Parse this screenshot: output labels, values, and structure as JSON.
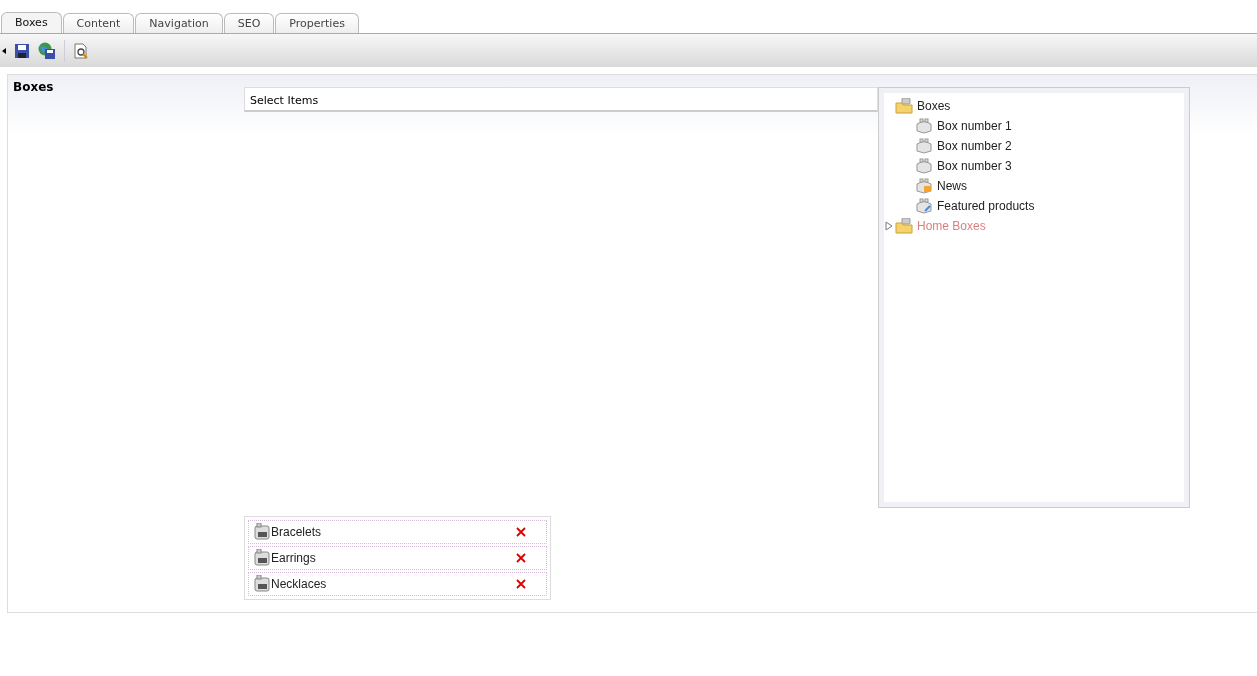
{
  "tabs": [
    {
      "label": "Boxes",
      "selected": true
    },
    {
      "label": "Content",
      "selected": false
    },
    {
      "label": "Navigation",
      "selected": false
    },
    {
      "label": "SEO",
      "selected": false
    },
    {
      "label": "Properties",
      "selected": false
    }
  ],
  "panel": {
    "label": "Boxes",
    "select_header": "Select Items",
    "tree": [
      {
        "label": "Boxes",
        "kind": "folder",
        "highlighted": false,
        "children": [
          {
            "label": "Box number 1",
            "kind": "box",
            "highlighted": false
          },
          {
            "label": "Box number 2",
            "kind": "box",
            "highlighted": false
          },
          {
            "label": "Box number 3",
            "kind": "box",
            "highlighted": false
          },
          {
            "label": "News",
            "kind": "news",
            "highlighted": false
          },
          {
            "label": "Featured products",
            "kind": "featured",
            "highlighted": false
          }
        ]
      },
      {
        "label": "Home Boxes",
        "kind": "folder",
        "highlighted": true,
        "expanded": false
      }
    ],
    "selected_items": [
      {
        "label": "Bracelets"
      },
      {
        "label": "Earrings"
      },
      {
        "label": "Necklaces"
      }
    ]
  }
}
